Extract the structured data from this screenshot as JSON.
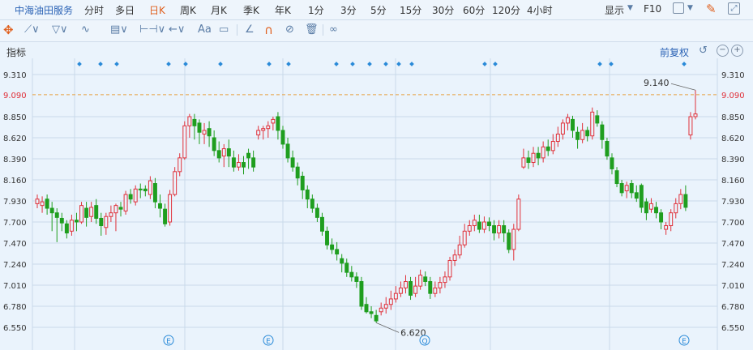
{
  "toolbar": {
    "title": "中海油田服务",
    "periods": [
      "分时",
      "多日",
      "日K",
      "周K",
      "月K",
      "季K",
      "年K",
      "1分",
      "3分",
      "5分",
      "15分",
      "30分",
      "60分",
      "120分",
      "4小时"
    ],
    "active_period": "日K",
    "show_label": "显示",
    "f10_label": "F10",
    "drawing_tools": [
      "move-icon",
      "line-icon",
      "channel-icon",
      "wave-icon",
      "fib-icon",
      "range-icon",
      "arrow-icon",
      "text-icon",
      "comment-icon",
      "measure-icon",
      "magnet-icon",
      "hide-icon",
      "delete-icon",
      "link-icon"
    ],
    "text_tool_label": "Aa"
  },
  "indicator_strip": {
    "label": "指标",
    "fuquan_label": "前复权"
  },
  "colors": {
    "up": "#e0313a",
    "down": "#1f9e1f",
    "accent": "#e0601e",
    "grid": "#c9d9ea",
    "axis_text": "#333333",
    "marker": "#2a8ad8"
  },
  "chart_data": {
    "type": "candlestick",
    "title": "中海油田服务",
    "ylim": [
      6.55,
      9.31
    ],
    "yticks": [
      6.55,
      6.78,
      7.01,
      7.24,
      7.47,
      7.7,
      7.93,
      8.16,
      8.39,
      8.62,
      8.85,
      9.09,
      9.31
    ],
    "ytick_labels": [
      "6.550",
      "6.780",
      "7.010",
      "7.240",
      "7.470",
      "7.700",
      "7.930",
      "8.160",
      "8.390",
      "8.620",
      "8.850",
      "9.090",
      "9.310"
    ],
    "current_price": 9.09,
    "current_price_label": "9.090",
    "high_label": "9.140",
    "low_label": "6.620",
    "ohlc": [
      [
        7.9,
        7.95,
        7.85,
        8.0
      ],
      [
        7.88,
        7.92,
        7.8,
        7.98
      ],
      [
        7.95,
        7.85,
        7.78,
        8.0
      ],
      [
        7.85,
        7.8,
        7.6,
        7.92
      ],
      [
        7.8,
        7.75,
        7.48,
        7.85
      ],
      [
        7.74,
        7.69,
        7.6,
        7.8
      ],
      [
        7.68,
        7.58,
        7.52,
        7.72
      ],
      [
        7.6,
        7.72,
        7.55,
        7.78
      ],
      [
        7.72,
        7.7,
        7.6,
        7.8
      ],
      [
        7.7,
        7.88,
        7.68,
        7.92
      ],
      [
        7.85,
        7.75,
        7.65,
        7.92
      ],
      [
        7.76,
        7.86,
        7.7,
        7.92
      ],
      [
        7.88,
        7.74,
        7.68,
        7.95
      ],
      [
        7.74,
        7.66,
        7.55,
        7.8
      ],
      [
        7.64,
        7.76,
        7.56,
        7.8
      ],
      [
        7.76,
        7.8,
        7.7,
        7.88
      ],
      [
        7.8,
        7.88,
        7.6,
        7.9
      ],
      [
        7.86,
        7.84,
        7.76,
        7.92
      ],
      [
        7.82,
        8.0,
        7.78,
        8.04
      ],
      [
        8.0,
        7.95,
        7.9,
        8.06
      ],
      [
        7.92,
        8.06,
        7.88,
        8.1
      ],
      [
        8.06,
        8.05,
        7.96,
        8.12
      ],
      [
        8.06,
        8.04,
        7.98,
        8.1
      ],
      [
        8.0,
        8.15,
        7.95,
        8.2
      ],
      [
        8.12,
        7.92,
        7.85,
        8.18
      ],
      [
        7.9,
        7.85,
        7.75,
        8.0
      ],
      [
        7.84,
        7.68,
        7.65,
        7.9
      ],
      [
        7.7,
        8.0,
        7.66,
        8.05
      ],
      [
        8.0,
        8.25,
        7.98,
        8.3
      ],
      [
        8.25,
        8.4,
        8.2,
        8.45
      ],
      [
        8.4,
        8.75,
        8.38,
        8.8
      ],
      [
        8.75,
        8.85,
        8.62,
        8.88
      ],
      [
        8.82,
        8.75,
        8.6,
        8.88
      ],
      [
        8.78,
        8.68,
        8.55,
        8.82
      ],
      [
        8.66,
        8.7,
        8.55,
        8.78
      ],
      [
        8.72,
        8.64,
        8.52,
        8.8
      ],
      [
        8.62,
        8.48,
        8.42,
        8.7
      ],
      [
        8.48,
        8.4,
        8.35,
        8.58
      ],
      [
        8.42,
        8.5,
        8.3,
        8.55
      ],
      [
        8.5,
        8.42,
        8.3,
        8.6
      ],
      [
        8.4,
        8.3,
        8.25,
        8.48
      ],
      [
        8.3,
        8.35,
        8.26,
        8.44
      ],
      [
        8.35,
        8.3,
        8.22,
        8.42
      ],
      [
        8.45,
        8.4,
        8.28,
        8.5
      ],
      [
        8.4,
        8.3,
        8.25,
        8.48
      ],
      [
        8.65,
        8.7,
        8.6,
        8.75
      ],
      [
        8.7,
        8.72,
        8.6,
        8.75
      ],
      [
        8.72,
        8.75,
        8.62,
        8.8
      ],
      [
        8.78,
        8.82,
        8.7,
        8.85
      ],
      [
        8.85,
        8.7,
        8.6,
        8.9
      ],
      [
        8.7,
        8.55,
        8.5,
        8.75
      ],
      [
        8.55,
        8.4,
        8.35,
        8.62
      ],
      [
        8.4,
        8.3,
        8.25,
        8.48
      ],
      [
        8.3,
        8.18,
        8.1,
        8.35
      ],
      [
        8.2,
        8.05,
        7.95,
        8.25
      ],
      [
        8.05,
        7.95,
        7.85,
        8.1
      ],
      [
        7.95,
        7.85,
        7.8,
        8.0
      ],
      [
        7.85,
        7.75,
        7.7,
        7.9
      ],
      [
        7.75,
        7.6,
        7.55,
        7.8
      ],
      [
        7.6,
        7.45,
        7.4,
        7.65
      ],
      [
        7.45,
        7.4,
        7.35,
        7.52
      ],
      [
        7.4,
        7.35,
        7.28,
        7.48
      ],
      [
        7.3,
        7.25,
        7.15,
        7.35
      ],
      [
        7.25,
        7.15,
        7.1,
        7.3
      ],
      [
        7.15,
        7.1,
        7.05,
        7.22
      ],
      [
        7.1,
        7.05,
        6.98,
        7.15
      ],
      [
        7.05,
        6.78,
        6.74,
        7.1
      ],
      [
        6.8,
        6.72,
        6.7,
        6.88
      ],
      [
        6.72,
        6.7,
        6.65,
        6.78
      ],
      [
        6.68,
        6.62,
        6.6,
        6.74
      ],
      [
        6.72,
        6.76,
        6.68,
        6.82
      ],
      [
        6.76,
        6.8,
        6.7,
        6.88
      ],
      [
        6.8,
        6.86,
        6.74,
        6.95
      ],
      [
        6.86,
        6.92,
        6.82,
        7.0
      ],
      [
        6.92,
        6.98,
        6.88,
        7.05
      ],
      [
        6.98,
        7.05,
        6.92,
        7.12
      ],
      [
        7.05,
        6.9,
        6.85,
        7.1
      ],
      [
        6.92,
        7.0,
        6.88,
        7.1
      ],
      [
        7.0,
        7.12,
        6.96,
        7.18
      ],
      [
        7.1,
        7.05,
        7.0,
        7.16
      ],
      [
        7.05,
        6.92,
        6.86,
        7.1
      ],
      [
        6.92,
        6.98,
        6.88,
        7.05
      ],
      [
        6.98,
        7.04,
        6.92,
        7.1
      ],
      [
        7.04,
        7.1,
        6.98,
        7.16
      ],
      [
        7.1,
        7.28,
        7.06,
        7.32
      ],
      [
        7.28,
        7.34,
        7.22,
        7.4
      ],
      [
        7.34,
        7.45,
        7.3,
        7.55
      ],
      [
        7.45,
        7.6,
        7.42,
        7.68
      ],
      [
        7.6,
        7.66,
        7.55,
        7.72
      ],
      [
        7.66,
        7.72,
        7.6,
        7.78
      ],
      [
        7.7,
        7.62,
        7.58,
        7.78
      ],
      [
        7.62,
        7.7,
        7.58,
        7.76
      ],
      [
        7.7,
        7.66,
        7.6,
        7.75
      ],
      [
        7.66,
        7.58,
        7.5,
        7.72
      ],
      [
        7.58,
        7.66,
        7.52,
        7.72
      ],
      [
        7.66,
        7.58,
        7.48,
        7.72
      ],
      [
        7.58,
        7.4,
        7.36,
        7.62
      ],
      [
        7.4,
        7.62,
        7.28,
        7.68
      ],
      [
        7.62,
        7.95,
        7.6,
        8.0
      ],
      [
        8.3,
        8.4,
        8.28,
        8.5
      ],
      [
        8.4,
        8.35,
        8.28,
        8.48
      ],
      [
        8.35,
        8.45,
        8.3,
        8.52
      ],
      [
        8.45,
        8.4,
        8.32,
        8.52
      ],
      [
        8.4,
        8.52,
        8.35,
        8.58
      ],
      [
        8.52,
        8.48,
        8.42,
        8.6
      ],
      [
        8.48,
        8.58,
        8.44,
        8.66
      ],
      [
        8.58,
        8.66,
        8.52,
        8.74
      ],
      [
        8.66,
        8.78,
        8.6,
        8.82
      ],
      [
        8.78,
        8.84,
        8.7,
        8.88
      ],
      [
        8.82,
        8.7,
        8.62,
        8.86
      ],
      [
        8.68,
        8.6,
        8.5,
        8.74
      ],
      [
        8.6,
        8.7,
        8.56,
        8.78
      ],
      [
        8.7,
        8.64,
        8.58,
        8.74
      ],
      [
        8.64,
        8.9,
        8.6,
        8.95
      ],
      [
        8.86,
        8.78,
        8.74,
        8.92
      ],
      [
        8.76,
        8.6,
        8.5,
        8.8
      ],
      [
        8.58,
        8.42,
        8.38,
        8.62
      ],
      [
        8.4,
        8.28,
        8.22,
        8.45
      ],
      [
        8.26,
        8.12,
        8.08,
        8.3
      ],
      [
        8.12,
        8.02,
        7.98,
        8.16
      ],
      [
        8.04,
        8.1,
        7.96,
        8.14
      ],
      [
        8.12,
        8.02,
        7.96,
        8.16
      ],
      [
        8.02,
        7.96,
        7.92,
        8.1
      ],
      [
        8.1,
        7.86,
        7.8,
        8.12
      ],
      [
        7.92,
        7.8,
        7.72,
        7.96
      ],
      [
        7.84,
        7.9,
        7.8,
        7.96
      ],
      [
        7.86,
        7.8,
        7.74,
        7.92
      ],
      [
        7.8,
        7.7,
        7.62,
        7.84
      ],
      [
        7.62,
        7.66,
        7.56,
        7.7
      ],
      [
        7.66,
        7.8,
        7.6,
        7.84
      ],
      [
        7.8,
        7.9,
        7.74,
        7.96
      ],
      [
        7.9,
        8.0,
        7.84,
        8.06
      ],
      [
        8.0,
        7.86,
        7.82,
        8.1
      ],
      [
        8.65,
        8.85,
        8.6,
        8.9
      ],
      [
        8.85,
        8.88,
        8.82,
        9.14
      ]
    ],
    "event_markers": [
      "E",
      "E",
      "Q",
      "E"
    ]
  }
}
